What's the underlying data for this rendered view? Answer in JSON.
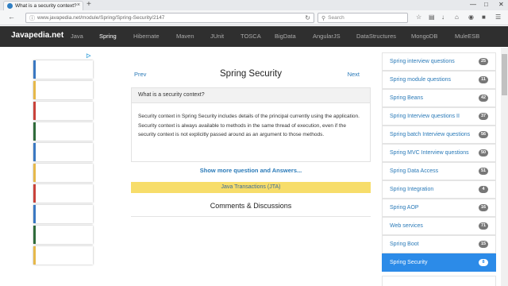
{
  "browser": {
    "tab_title": "What is a security context?",
    "tab_close": "×",
    "new_tab": "+",
    "url": "www.javapedia.net/module/Spring/Spring-Security/2147",
    "search_placeholder": "Search",
    "icons": [
      "back-icon",
      "lock-icon",
      "reload-icon",
      "search-icon",
      "star-icon",
      "reading-list-icon",
      "download-icon",
      "home-icon",
      "pocket-icon",
      "menu-icon"
    ]
  },
  "site": {
    "brand": "Javapedia.net",
    "menu": [
      "Java",
      "Spring",
      "Hibernate",
      "Maven",
      "JUnit",
      "TOSCA",
      "BigData",
      "AngularJS",
      "DataStructures",
      "MongoDB",
      "MuleESB"
    ],
    "active_menu": "Spring"
  },
  "main": {
    "prev": "Prev",
    "next": "Next",
    "title": "Spring Security",
    "question": "What is a security context?",
    "answer": "Security context in Spring Security includes details of the principal currently using the application. Security context is always available to methods in the same thread of execution, even if the security context is not explicitly passed around as an argument to those methods.",
    "more_link": "Show more question and Answers...",
    "banner": "Java Transactions (JTA)",
    "comments_title": "Comments & Discussions"
  },
  "sidebar": {
    "items": [
      {
        "label": "Spring interview questions",
        "count": "25"
      },
      {
        "label": "Spring module questions",
        "count": "11"
      },
      {
        "label": "Spring Beans",
        "count": "42"
      },
      {
        "label": "Spring Interview questions II",
        "count": "37"
      },
      {
        "label": "Spring batch Interview questions",
        "count": "56"
      },
      {
        "label": "Spring MVC Interview questions",
        "count": "50"
      },
      {
        "label": "Spring Data Access",
        "count": "51"
      },
      {
        "label": "Spring Integration",
        "count": "4"
      },
      {
        "label": "Spring AOP",
        "count": "16"
      },
      {
        "label": "Web services",
        "count": "71"
      },
      {
        "label": "Spring Boot",
        "count": "15"
      },
      {
        "label": "Spring Security",
        "count": "8"
      }
    ],
    "active": "Spring Security"
  },
  "colors": {
    "header_bg": "#2f2f2f",
    "link": "#2a7ab8",
    "banner": "#f7dd6a",
    "active_item": "#2c8be8",
    "badge": "#777777"
  }
}
